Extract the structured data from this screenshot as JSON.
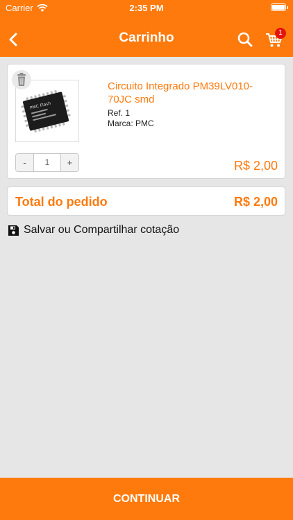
{
  "status_bar": {
    "carrier": "Carrier",
    "time": "2:35 PM"
  },
  "nav": {
    "title": "Carrinho",
    "back_icon": "chevron-left-icon",
    "search_icon": "search-icon",
    "cart_icon": "cart-icon",
    "cart_count": "1"
  },
  "cart_item": {
    "name": "Circuito Integrado PM39LV010-70JC smd",
    "ref": "Ref. 1",
    "brand": "Marca: PMC",
    "quantity": "1",
    "minus_label": "-",
    "plus_label": "+",
    "price": "R$ 2,00",
    "chip_text": "PMC Flash"
  },
  "total": {
    "label": "Total do pedido",
    "value": "R$ 2,00"
  },
  "save_link": {
    "label": "Salvar ou Compartilhar cotação",
    "icon": "floppy-disk-icon"
  },
  "footer": {
    "continue_label": "CONTINUAR"
  },
  "colors": {
    "accent": "#ff7a0d",
    "badge": "#e3140e",
    "background": "#e6e6e6"
  }
}
